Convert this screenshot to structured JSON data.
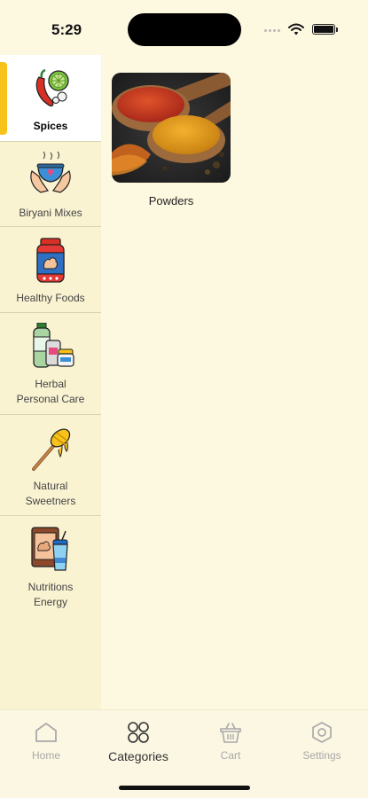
{
  "status_bar": {
    "time": "5:29"
  },
  "sidebar": {
    "items": [
      {
        "label": "Spices",
        "icon": "chili-lime-icon",
        "active": true
      },
      {
        "label": "Biryani Mixes",
        "icon": "biryani-bowl-icon",
        "active": false
      },
      {
        "label": "Healthy Foods",
        "icon": "protein-jar-icon",
        "active": false
      },
      {
        "label": "Herbal\nPersonal Care",
        "icon": "cosmetics-icon",
        "active": false
      },
      {
        "label": "Natural\nSweetners",
        "icon": "honey-dipper-icon",
        "active": false
      },
      {
        "label": "Nutritions\nEnergy",
        "icon": "energy-drink-icon",
        "active": false
      }
    ]
  },
  "content": {
    "subcategories": [
      {
        "label": "Powders",
        "image": "spice-powders-photo"
      }
    ]
  },
  "bottom_nav": {
    "items": [
      {
        "label": "Home",
        "icon": "home-icon",
        "active": false
      },
      {
        "label": "Categories",
        "icon": "grid-circles-icon",
        "active": true
      },
      {
        "label": "Cart",
        "icon": "basket-icon",
        "active": false
      },
      {
        "label": "Settings",
        "icon": "settings-icon",
        "active": false
      }
    ]
  },
  "colors": {
    "background": "#fdf8e0",
    "sidebar": "#faf3d2",
    "accent": "#f7c21a",
    "inactive": "#a9a9a9"
  }
}
